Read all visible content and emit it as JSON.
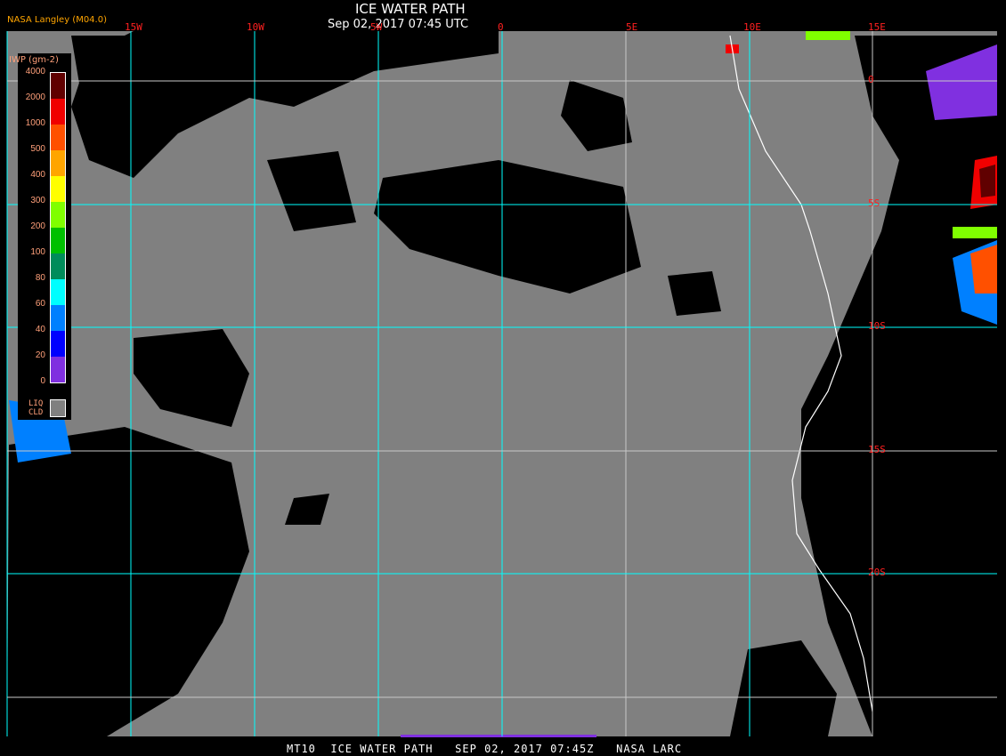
{
  "header": {
    "title": "ICE WATER PATH",
    "datetime": "Sep 02, 2017 07:45 UTC",
    "credit": "NASA Langley (M04.0)"
  },
  "longitude_labels": [
    "15W",
    "10W",
    "5W",
    "0",
    "5E",
    "10E",
    "15E"
  ],
  "latitude_labels": [
    "0",
    "5S",
    "10S",
    "15S",
    "20S"
  ],
  "legend": {
    "unit": "IWP (gm-2)",
    "ticks": [
      "4000",
      "2000",
      "1000",
      "500",
      "400",
      "300",
      "200",
      "100",
      "80",
      "60",
      "40",
      "20",
      "0"
    ],
    "colors": [
      "#600000",
      "#f00000",
      "#ff5000",
      "#ffa500",
      "#ffff00",
      "#80ff00",
      "#00c000",
      "#008c5a",
      "#00ffff",
      "#0080ff",
      "#0000ff",
      "#8030e0"
    ],
    "liq_label": "LIQ",
    "cld_label": "CLD",
    "liq_color": "#808080"
  },
  "footer": "MT10  ICE WATER PATH   SEP 02, 2017 07:45Z   NASA LARC"
}
